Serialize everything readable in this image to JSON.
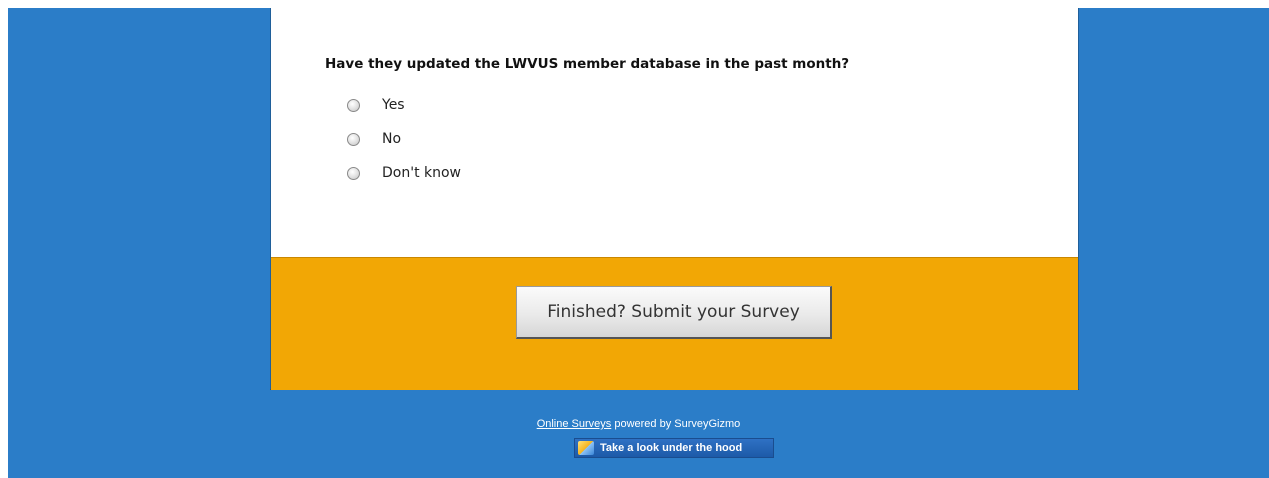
{
  "survey": {
    "question": "Have they updated the LWVUS member database in the past month?",
    "options": [
      {
        "label": "Yes",
        "selected": false
      },
      {
        "label": "No",
        "selected": false
      },
      {
        "label": "Don't know",
        "selected": false
      }
    ],
    "submit_label": "Finished? Submit your Survey"
  },
  "footer": {
    "link_text": "Online Surveys",
    "powered_text": "powered by SurveyGizmo",
    "badge_text": "Take a look under the hood"
  },
  "colors": {
    "page_background": "#2b7dc8",
    "footer_band": "#f2a705",
    "card": "#ffffff"
  },
  "icons": {
    "badge_icon": "surveygizmo-logo-icon"
  }
}
